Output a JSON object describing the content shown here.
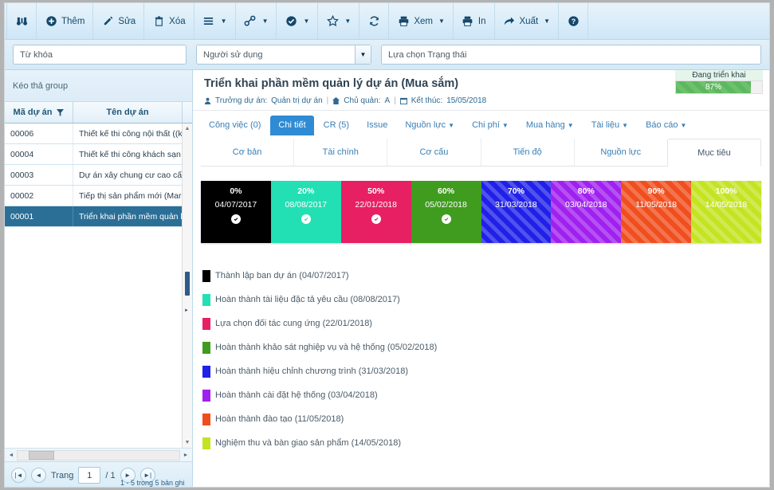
{
  "toolbar": {
    "items": [
      {
        "icon": "binoculars-icon",
        "label": "",
        "caret": false
      },
      {
        "icon": "plus-circle-icon",
        "label": "Thêm",
        "caret": false
      },
      {
        "icon": "pencil-icon",
        "label": "Sửa",
        "caret": false
      },
      {
        "icon": "trash-icon",
        "label": "Xóa",
        "caret": false
      },
      {
        "icon": "list-icon",
        "label": "",
        "caret": true
      },
      {
        "icon": "link-icon",
        "label": "",
        "caret": true
      },
      {
        "icon": "check-circle-icon",
        "label": "",
        "caret": true
      },
      {
        "icon": "star-icon",
        "label": "",
        "caret": true
      },
      {
        "icon": "refresh-icon",
        "label": "",
        "caret": false
      },
      {
        "icon": "printer-icon",
        "label": "Xem",
        "caret": true
      },
      {
        "icon": "printer-icon",
        "label": "In",
        "caret": false
      },
      {
        "icon": "export-arrow-icon",
        "label": "Xuất",
        "caret": true
      },
      {
        "icon": "help-circle-icon",
        "label": "",
        "caret": false
      }
    ]
  },
  "filters": {
    "keyword_placeholder": "Từ khóa",
    "keyword_value": "",
    "user_placeholder": "Người sử dụng",
    "user_value": "",
    "status_placeholder": "Lựa chọn Trạng thái",
    "status_value": ""
  },
  "left_panel": {
    "group_bar": "Kéo thả group",
    "columns": [
      "Mã dự án",
      "Tên dự án"
    ],
    "rows": [
      {
        "code": "00001",
        "name": "Triển khai phần mềm quản lý dự án (M",
        "selected": true
      },
      {
        "code": "00002",
        "name": "Tiếp thị sản phẩm mới (Marketing)",
        "selected": false
      },
      {
        "code": "00003",
        "name": "Dự án xây chung cư cao cấp A (Xây d",
        "selected": false
      },
      {
        "code": "00004",
        "name": "Thiết kế thi công khách sạn B (Xây lắ",
        "selected": false
      },
      {
        "code": "00006",
        "name": "Thiết kế thi công nội thất ((kiến trúc)",
        "selected": false
      }
    ],
    "pager": {
      "label": "Trang",
      "page": "1",
      "total": "/ 1",
      "note": "1 - 5 trong 5 bản ghi"
    }
  },
  "project": {
    "title": "Triển khai phần mềm quản lý dự án (Mua sắm)",
    "manager_label": "Trưởng dự án:",
    "manager_value": "Quản trị dự án",
    "owner_label": "Chủ quản:",
    "owner_value": "A",
    "end_label": "Kết thúc:",
    "end_value": "15/05/2018",
    "status_label": "Đang triển khai",
    "status_percent": "87%"
  },
  "tabs_primary": [
    {
      "label": "Công việc (0)",
      "active": false,
      "caret": false
    },
    {
      "label": "Chi tiết",
      "active": true,
      "caret": false
    },
    {
      "label": "CR (5)",
      "active": false,
      "caret": false
    },
    {
      "label": "Issue",
      "active": false,
      "caret": false
    },
    {
      "label": "Nguồn lực",
      "active": false,
      "caret": true
    },
    {
      "label": "Chi phí",
      "active": false,
      "caret": true
    },
    {
      "label": "Mua hàng",
      "active": false,
      "caret": true
    },
    {
      "label": "Tài liệu",
      "active": false,
      "caret": true
    },
    {
      "label": "Báo cáo",
      "active": false,
      "caret": true
    }
  ],
  "tabs_secondary": [
    {
      "label": "Cơ bản",
      "active": false
    },
    {
      "label": "Tài chính",
      "active": false
    },
    {
      "label": "Cơ cấu",
      "active": false
    },
    {
      "label": "Tiến độ",
      "active": false
    },
    {
      "label": "Nguồn lực",
      "active": false
    },
    {
      "label": "Mục tiêu",
      "active": true
    }
  ],
  "chart_data": {
    "type": "timeline",
    "title": "Mục tiêu",
    "milestones": [
      {
        "percent": "0%",
        "date": "04/07/2017",
        "color": "#000000",
        "done": true,
        "striped": false
      },
      {
        "percent": "20%",
        "date": "08/08/2017",
        "color": "#22e0b4",
        "done": true,
        "striped": false
      },
      {
        "percent": "50%",
        "date": "22/01/2018",
        "color": "#e71f63",
        "done": true,
        "striped": false
      },
      {
        "percent": "60%",
        "date": "05/02/2018",
        "color": "#3f9c1e",
        "done": true,
        "striped": false
      },
      {
        "percent": "70%",
        "date": "31/03/2018",
        "color": "#2020e8",
        "done": false,
        "striped": true
      },
      {
        "percent": "80%",
        "date": "03/04/2018",
        "color": "#a020ef",
        "done": false,
        "striped": true
      },
      {
        "percent": "90%",
        "date": "11/05/2018",
        "color": "#f04e1e",
        "done": false,
        "striped": true
      },
      {
        "percent": "100%",
        "date": "14/05/2018",
        "color": "#c4e321",
        "done": false,
        "striped": true
      }
    ],
    "legend": [
      {
        "color": "#000000",
        "text": "Thành lập ban dự án (04/07/2017)"
      },
      {
        "color": "#22e0b4",
        "text": "Hoàn thành tài liệu đặc tả yêu cầu (08/08/2017)"
      },
      {
        "color": "#e71f63",
        "text": "Lựa chọn đối tác cung ứng (22/01/2018)"
      },
      {
        "color": "#3f9c1e",
        "text": "Hoàn thành khảo sát nghiệp vụ và hệ thống (05/02/2018)"
      },
      {
        "color": "#2020e8",
        "text": "Hoàn thành hiệu chỉnh chương trình (31/03/2018)"
      },
      {
        "color": "#a020ef",
        "text": "Hoàn thành cài đặt hệ thống (03/04/2018)"
      },
      {
        "color": "#f04e1e",
        "text": "Hoàn thành đào tạo (11/05/2018)"
      },
      {
        "color": "#c4e321",
        "text": "Nghiệm thu và bàn giao sản phẩm (14/05/2018)"
      }
    ]
  }
}
